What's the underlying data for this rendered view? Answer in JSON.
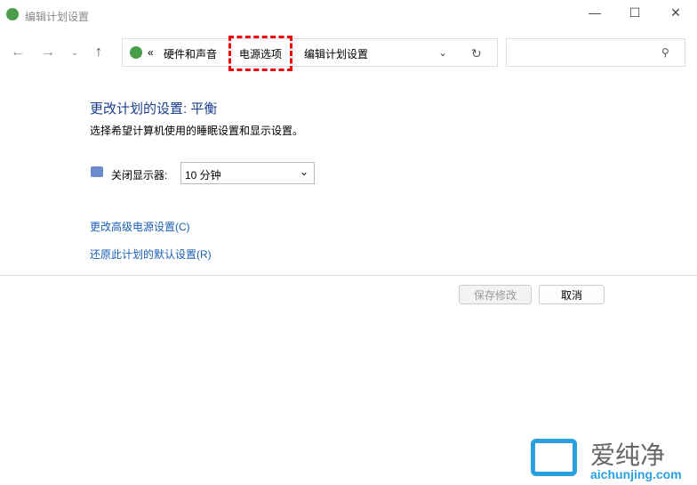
{
  "window": {
    "title": "编辑计划设置"
  },
  "address": {
    "prefix": "«",
    "crumbs": [
      "硬件和声音",
      "电源选项",
      "编辑计划设置"
    ]
  },
  "main": {
    "heading": "更改计划的设置: 平衡",
    "subtitle": "选择希望计算机使用的睡眠设置和显示设置。",
    "display_label": "关闭显示器:",
    "display_value": "10 分钟",
    "link_advanced": "更改高级电源设置(C)",
    "link_restore": "还原此计划的默认设置(R)"
  },
  "buttons": {
    "save": "保存修改",
    "cancel": "取消"
  },
  "watermark": {
    "name": "爱纯净",
    "url": "aichunjing.com"
  }
}
